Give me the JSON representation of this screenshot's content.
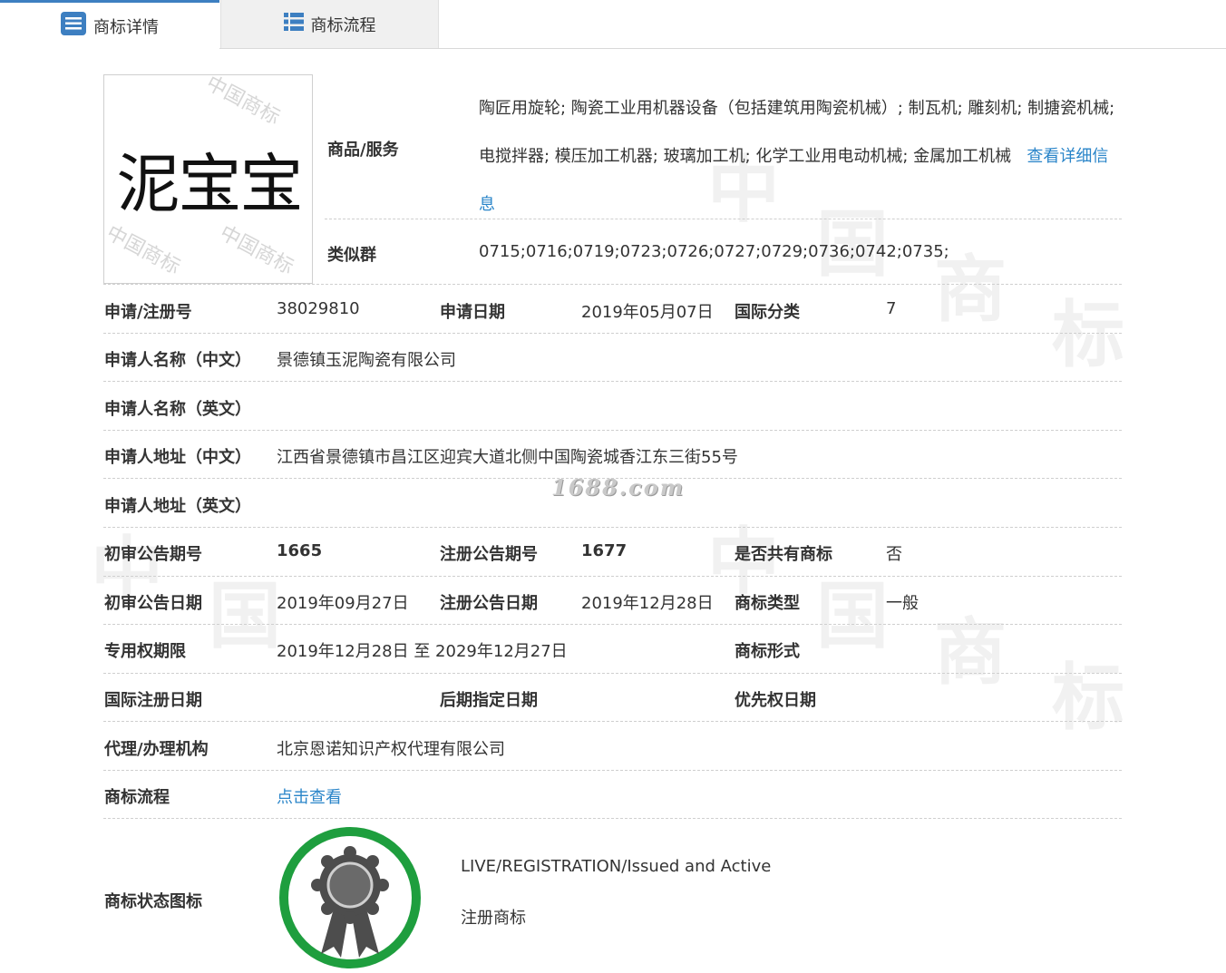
{
  "tabs": [
    {
      "label": "商标详情",
      "icon": "list-icon"
    },
    {
      "label": "商标流程",
      "icon": "grid-list-icon"
    }
  ],
  "trademark": {
    "name": "泥宝宝",
    "image_watermark": "中国商标"
  },
  "goods_services": {
    "label": "商品/服务",
    "text": "陶匠用旋轮; 陶瓷工业用机器设备（包括建筑用陶瓷机械）; 制瓦机; 雕刻机; 制搪瓷机械; 电搅拌器; 模压加工机器; 玻璃加工机; 化学工业用电动机械; 金属加工机械",
    "link_label": "查看详细信息"
  },
  "similar_group": {
    "label": "类似群",
    "value": "0715;0716;0719;0723;0726;0727;0729;0736;0742;0735;"
  },
  "fields": {
    "reg_no_label": "申请/注册号",
    "reg_no": "38029810",
    "apply_date_label": "申请日期",
    "apply_date": "2019年05月07日",
    "intl_class_label": "国际分类",
    "intl_class": "7",
    "applicant_cn_label": "申请人名称（中文）",
    "applicant_cn": "景德镇玉泥陶瓷有限公司",
    "applicant_en_label": "申请人名称（英文）",
    "applicant_en": "",
    "address_cn_label": "申请人地址（中文）",
    "address_cn": "江西省景德镇市昌江区迎宾大道北侧中国陶瓷城香江东三街55号",
    "address_en_label": "申请人地址（英文）",
    "address_en": "",
    "prelim_no_label": "初审公告期号",
    "prelim_no": "1665",
    "reg_pub_no_label": "注册公告期号",
    "reg_pub_no": "1677",
    "shared_label": "是否共有商标",
    "shared": "否",
    "prelim_date_label": "初审公告日期",
    "prelim_date": "2019年09月27日",
    "reg_pub_date_label": "注册公告日期",
    "reg_pub_date": "2019年12月28日",
    "tm_type_label": "商标类型",
    "tm_type": "一般",
    "exclusive_label": "专用权期限",
    "exclusive": "2019年12月28日 至 2029年12月27日",
    "tm_form_label": "商标形式",
    "tm_form": "",
    "intl_reg_date_label": "国际注册日期",
    "later_date_label": "后期指定日期",
    "priority_date_label": "优先权日期",
    "agent_label": "代理/办理机构",
    "agent": "北京恩诺知识产权代理有限公司",
    "flow_label": "商标流程",
    "flow_link": "点击查看",
    "status_icon_label": "商标状态图标"
  },
  "status": {
    "en": "LIVE/REGISTRATION/Issued and Active",
    "cn": "注册商标",
    "ring_color": "#1e9e3e"
  },
  "watermark": "1688.com",
  "colors": {
    "link": "#2a85c9",
    "tab_accent": "#3d7fc1"
  }
}
